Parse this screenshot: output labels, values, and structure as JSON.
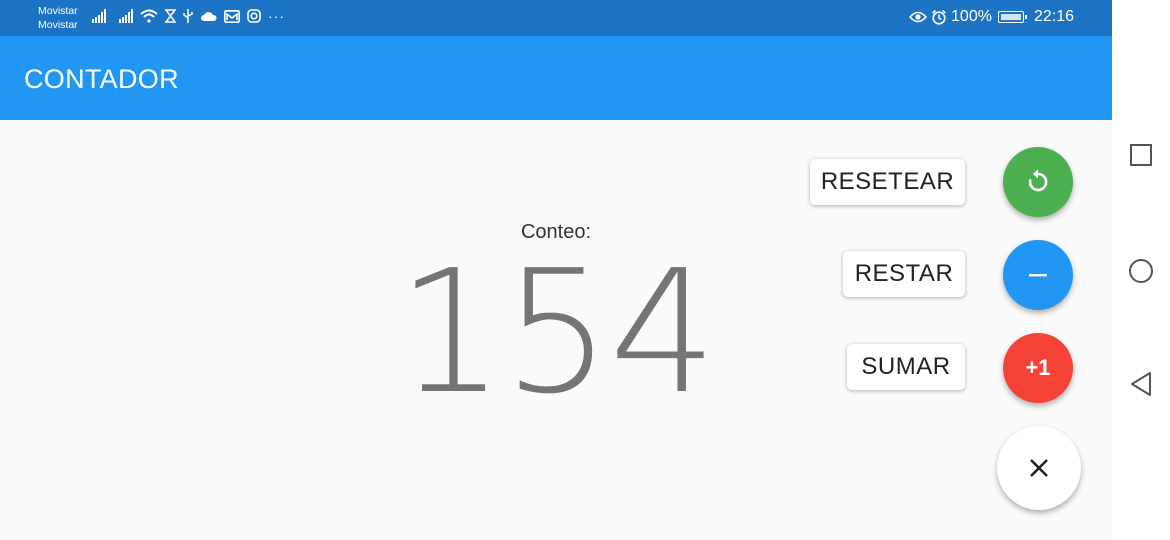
{
  "status_bar": {
    "carrier_1": "Movistar",
    "carrier_2": "Movistar",
    "battery": "100%",
    "time": "22:16",
    "icons_left": [
      "signal-icon",
      "signal-icon",
      "wifi-icon",
      "hourglass-icon",
      "usb-icon",
      "cloud-icon",
      "mail-icon",
      "instagram-icon",
      "more-icon"
    ],
    "icons_right": [
      "eye-icon",
      "alarm-icon",
      "battery-icon"
    ]
  },
  "app_bar": {
    "title": "CONTADOR",
    "color": "#2196f3"
  },
  "counter": {
    "label": "Conteo:",
    "value": "154"
  },
  "actions": {
    "reset": {
      "label": "RESETEAR",
      "icon": "reset-icon",
      "color": "#4caf50"
    },
    "subtract": {
      "label": "RESTAR",
      "icon": "minus-icon",
      "color": "#2196f3"
    },
    "add": {
      "label": "SUMAR",
      "fab_text": "+1",
      "color": "#f44336"
    },
    "close": {
      "icon": "close-icon",
      "color": "#ffffff"
    }
  },
  "nav_bar": {
    "icons": [
      "square-icon",
      "circle-icon",
      "back-triangle-icon"
    ]
  }
}
